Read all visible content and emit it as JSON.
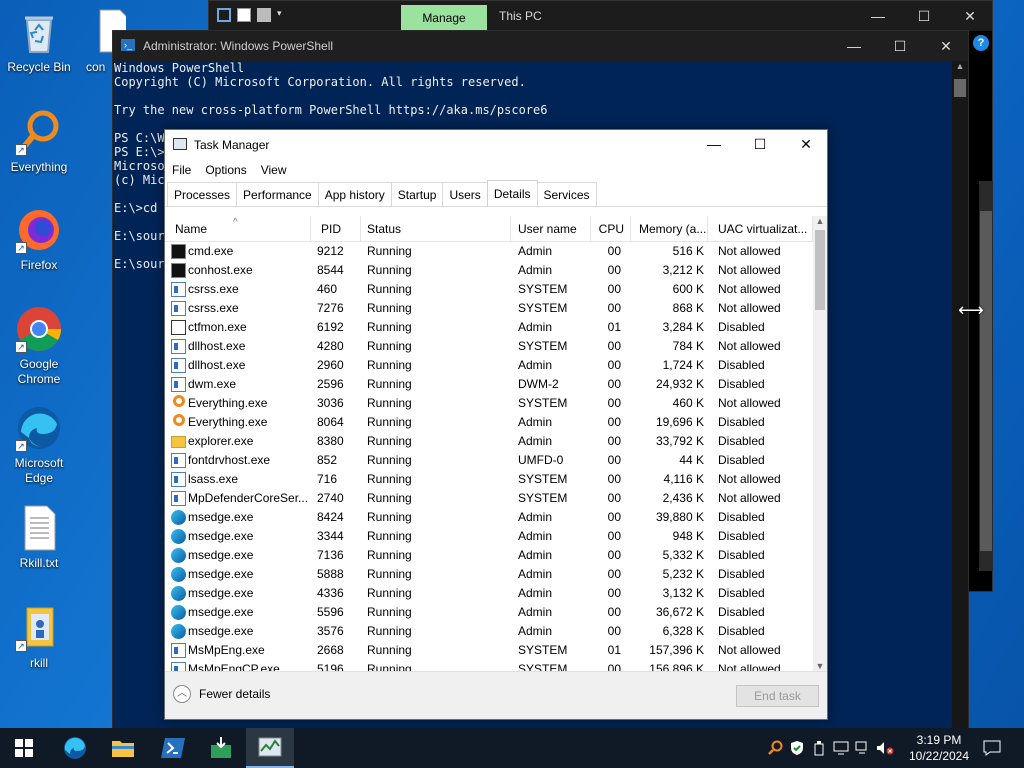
{
  "desktop": {
    "icons": [
      {
        "label": "Recycle Bin"
      },
      {
        "label": "Everything"
      },
      {
        "label": "Firefox"
      },
      {
        "label": "Google Chrome"
      },
      {
        "label": "Microsoft Edge"
      },
      {
        "label": "Rkill.txt"
      },
      {
        "label": "rkill"
      },
      {
        "label": "con"
      }
    ]
  },
  "explorer": {
    "manage_tab": "Manage",
    "title": "This PC",
    "help": "?"
  },
  "powershell": {
    "title": "Administrator: Windows PowerShell",
    "lines": [
      "Windows PowerShell",
      "Copyright (C) Microsoft Corporation. All rights reserved.",
      "",
      "Try the new cross-platform PowerShell https://aka.ms/pscore6",
      "",
      "PS C:\\W",
      "PS E:\\>",
      "Microso",
      "(c) Mic",
      "",
      "E:\\>cd s",
      "",
      "E:\\sour",
      "",
      "E:\\sour"
    ]
  },
  "taskmanager": {
    "title": "Task Manager",
    "menu": [
      "File",
      "Options",
      "View"
    ],
    "tabs": [
      "Processes",
      "Performance",
      "App history",
      "Startup",
      "Users",
      "Details",
      "Services"
    ],
    "active_tab": "Details",
    "columns": [
      "Name",
      "PID",
      "Status",
      "User name",
      "CPU",
      "Memory (a...",
      "UAC virtualizat..."
    ],
    "rows": [
      {
        "icon": "cmd-icon",
        "name": "cmd.exe",
        "pid": "9212",
        "status": "Running",
        "user": "Admin",
        "cpu": "00",
        "mem": "516 K",
        "uac": "Not allowed"
      },
      {
        "icon": "cmd-icon",
        "name": "conhost.exe",
        "pid": "8544",
        "status": "Running",
        "user": "Admin",
        "cpu": "00",
        "mem": "3,212 K",
        "uac": "Not allowed"
      },
      {
        "icon": "window-icon",
        "name": "csrss.exe",
        "pid": "460",
        "status": "Running",
        "user": "SYSTEM",
        "cpu": "00",
        "mem": "600 K",
        "uac": "Not allowed"
      },
      {
        "icon": "window-icon",
        "name": "csrss.exe",
        "pid": "7276",
        "status": "Running",
        "user": "SYSTEM",
        "cpu": "00",
        "mem": "868 K",
        "uac": "Not allowed"
      },
      {
        "icon": "ctfmon-icon",
        "name": "ctfmon.exe",
        "pid": "6192",
        "status": "Running",
        "user": "Admin",
        "cpu": "01",
        "mem": "3,284 K",
        "uac": "Disabled"
      },
      {
        "icon": "window-icon",
        "name": "dllhost.exe",
        "pid": "4280",
        "status": "Running",
        "user": "SYSTEM",
        "cpu": "00",
        "mem": "784 K",
        "uac": "Not allowed"
      },
      {
        "icon": "window-icon",
        "name": "dllhost.exe",
        "pid": "2960",
        "status": "Running",
        "user": "Admin",
        "cpu": "00",
        "mem": "1,724 K",
        "uac": "Disabled"
      },
      {
        "icon": "window-icon",
        "name": "dwm.exe",
        "pid": "2596",
        "status": "Running",
        "user": "DWM-2",
        "cpu": "00",
        "mem": "24,932 K",
        "uac": "Disabled"
      },
      {
        "icon": "everything-icon",
        "name": "Everything.exe",
        "pid": "3036",
        "status": "Running",
        "user": "SYSTEM",
        "cpu": "00",
        "mem": "460 K",
        "uac": "Not allowed"
      },
      {
        "icon": "everything-icon",
        "name": "Everything.exe",
        "pid": "8064",
        "status": "Running",
        "user": "Admin",
        "cpu": "00",
        "mem": "19,696 K",
        "uac": "Disabled"
      },
      {
        "icon": "folder-icon",
        "name": "explorer.exe",
        "pid": "8380",
        "status": "Running",
        "user": "Admin",
        "cpu": "00",
        "mem": "33,792 K",
        "uac": "Disabled"
      },
      {
        "icon": "window-icon",
        "name": "fontdrvhost.exe",
        "pid": "852",
        "status": "Running",
        "user": "UMFD-0",
        "cpu": "00",
        "mem": "44 K",
        "uac": "Disabled"
      },
      {
        "icon": "window-icon",
        "name": "lsass.exe",
        "pid": "716",
        "status": "Running",
        "user": "SYSTEM",
        "cpu": "00",
        "mem": "4,116 K",
        "uac": "Not allowed"
      },
      {
        "icon": "window-icon",
        "name": "MpDefenderCoreSer...",
        "pid": "2740",
        "status": "Running",
        "user": "SYSTEM",
        "cpu": "00",
        "mem": "2,436 K",
        "uac": "Not allowed"
      },
      {
        "icon": "edge-icon",
        "name": "msedge.exe",
        "pid": "8424",
        "status": "Running",
        "user": "Admin",
        "cpu": "00",
        "mem": "39,880 K",
        "uac": "Disabled"
      },
      {
        "icon": "edge-icon",
        "name": "msedge.exe",
        "pid": "3344",
        "status": "Running",
        "user": "Admin",
        "cpu": "00",
        "mem": "948 K",
        "uac": "Disabled"
      },
      {
        "icon": "edge-icon",
        "name": "msedge.exe",
        "pid": "7136",
        "status": "Running",
        "user": "Admin",
        "cpu": "00",
        "mem": "5,332 K",
        "uac": "Disabled"
      },
      {
        "icon": "edge-icon",
        "name": "msedge.exe",
        "pid": "5888",
        "status": "Running",
        "user": "Admin",
        "cpu": "00",
        "mem": "5,232 K",
        "uac": "Disabled"
      },
      {
        "icon": "edge-icon",
        "name": "msedge.exe",
        "pid": "4336",
        "status": "Running",
        "user": "Admin",
        "cpu": "00",
        "mem": "3,132 K",
        "uac": "Disabled"
      },
      {
        "icon": "edge-icon",
        "name": "msedge.exe",
        "pid": "5596",
        "status": "Running",
        "user": "Admin",
        "cpu": "00",
        "mem": "36,672 K",
        "uac": "Disabled"
      },
      {
        "icon": "edge-icon",
        "name": "msedge.exe",
        "pid": "3576",
        "status": "Running",
        "user": "Admin",
        "cpu": "00",
        "mem": "6,328 K",
        "uac": "Disabled"
      },
      {
        "icon": "window-icon",
        "name": "MsMpEng.exe",
        "pid": "2668",
        "status": "Running",
        "user": "SYSTEM",
        "cpu": "01",
        "mem": "157,396 K",
        "uac": "Not allowed"
      },
      {
        "icon": "window-icon",
        "name": "MsMpEngCP.exe",
        "pid": "5196",
        "status": "Running",
        "user": "SYSTEM",
        "cpu": "00",
        "mem": "156,896 K",
        "uac": "Not allowed"
      }
    ],
    "fewer_details": "Fewer details",
    "end_task": "End task"
  },
  "taskbar": {
    "time": "3:19 PM",
    "date": "10/22/2024"
  }
}
